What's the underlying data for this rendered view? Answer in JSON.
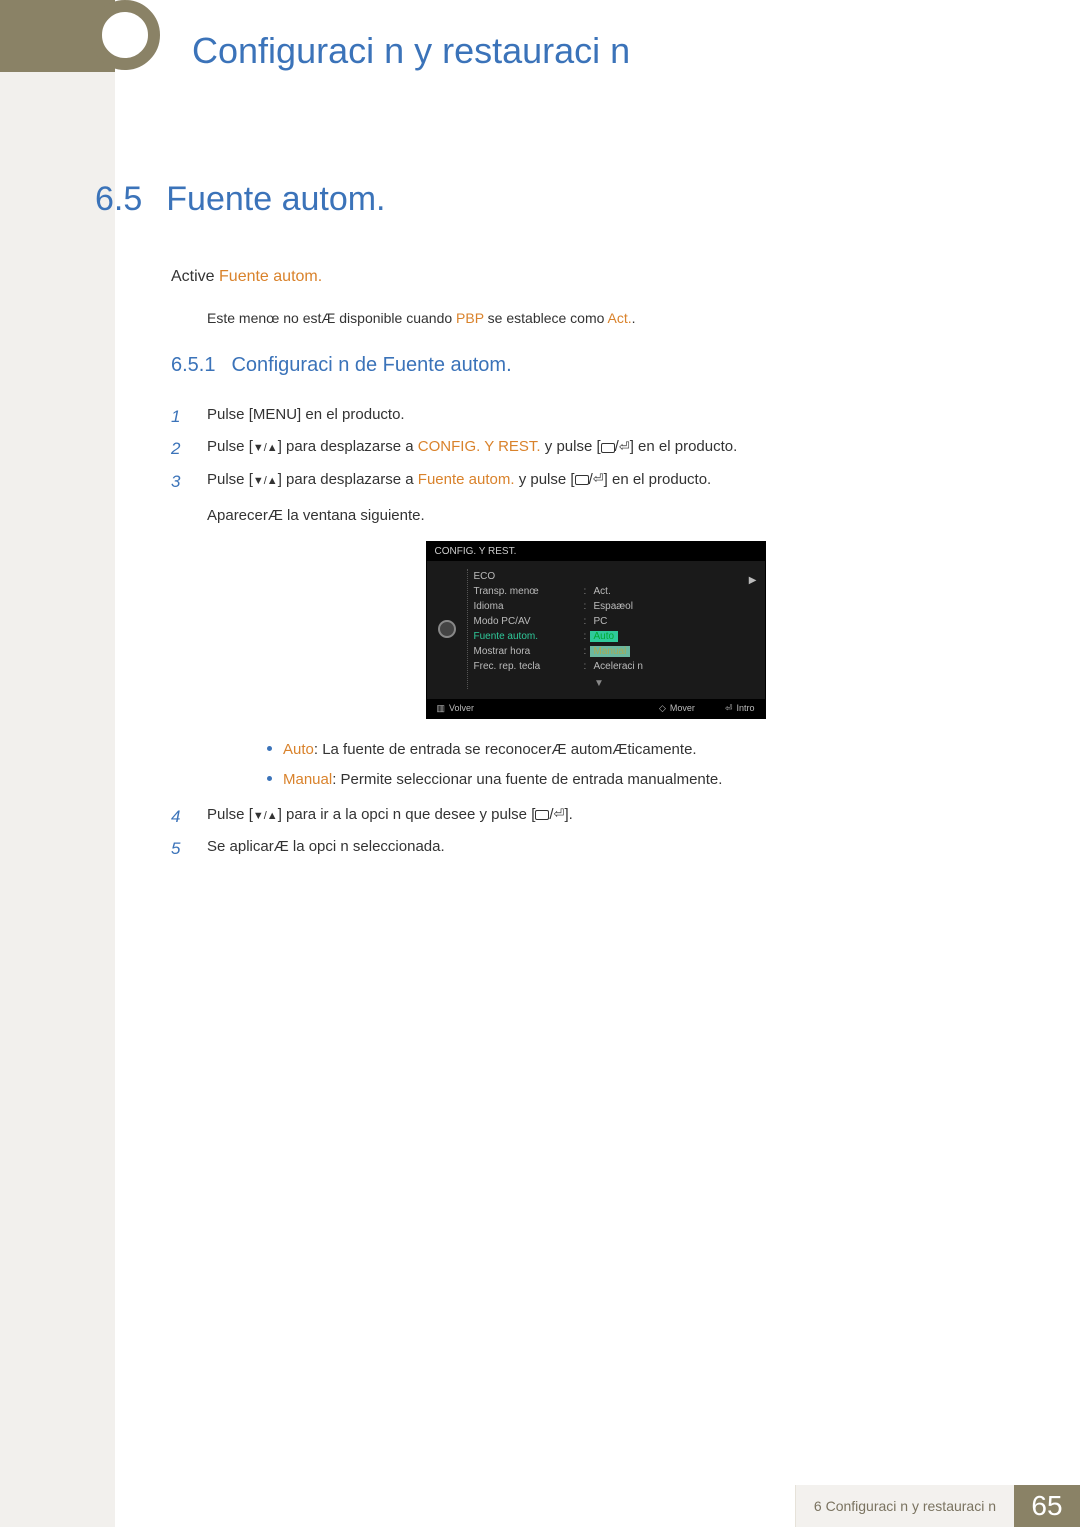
{
  "chapter": {
    "title": "Configuraci n y restauraci n"
  },
  "section": {
    "num": "6.5",
    "title": "Fuente autom."
  },
  "intro": {
    "prefix": "Active ",
    "keyword": "Fuente autom."
  },
  "note": {
    "p1": "Este menœ no estÆ disponible cuando ",
    "k1": "PBP",
    "p2": " se establece como ",
    "k2": "Act.",
    "p3": "."
  },
  "subsection": {
    "num": "6.5.1",
    "title": "Configuraci n de Fuente autom."
  },
  "steps": {
    "s1": {
      "num": "1",
      "a": "Pulse [",
      "menu": "MENU",
      "b": "] en el producto."
    },
    "s2": {
      "num": "2",
      "a": "Pulse [",
      "b": "] para desplazarse a ",
      "k": "CONFIG. Y REST.",
      "c": " y pulse [",
      "d": "] en el producto."
    },
    "s3": {
      "num": "3",
      "a": "Pulse [",
      "b": "] para desplazarse a ",
      "k": "Fuente autom.",
      "c": " y pulse [",
      "d": "] en el producto.",
      "e": "AparecerÆ la ventana siguiente."
    },
    "s4": {
      "num": "4",
      "a": "Pulse [",
      "b": "] para ir a la opci n que desee y pulse [",
      "c": "]."
    },
    "s5": {
      "num": "5",
      "a": "Se aplicarÆ la opci n seleccionada."
    }
  },
  "osd": {
    "header": "CONFIG. Y REST.",
    "rows": {
      "eco": {
        "label": "ECO",
        "val": ""
      },
      "transp": {
        "label": "Transp. menœ",
        "val": "Act."
      },
      "idioma": {
        "label": "Idioma",
        "val": "Espaæol"
      },
      "modo": {
        "label": "Modo PC/AV",
        "val": "PC"
      },
      "fuente": {
        "label": "Fuente autom.",
        "opt1": "Auto",
        "opt2": "Manual"
      },
      "mostrar": {
        "label": "Mostrar hora",
        "val": ""
      },
      "frec": {
        "label": "Frec. rep. tecla",
        "val": "Aceleraci n"
      }
    },
    "footer": {
      "volver": "Volver",
      "mover": "Mover",
      "intro": "Intro"
    }
  },
  "bullets": {
    "auto": {
      "k": "Auto",
      "t": ": La fuente de entrada se reconocerÆ automÆticamente."
    },
    "manual": {
      "k": "Manual",
      "t": ": Permite seleccionar una fuente de entrada manualmente."
    }
  },
  "footer": {
    "text": "6 Configuraci n y restauraci n",
    "page": "65"
  }
}
